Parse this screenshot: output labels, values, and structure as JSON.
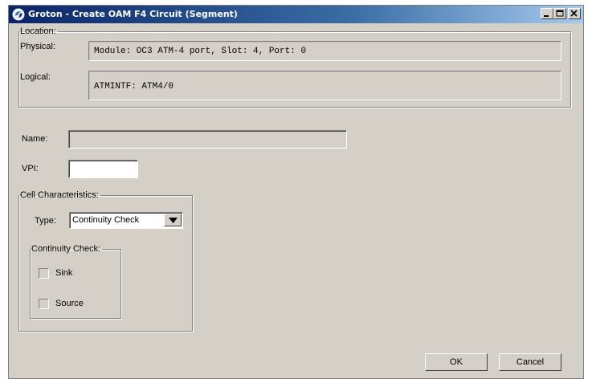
{
  "window": {
    "title": "Groton - Create OAM F4 Circuit (Segment)"
  },
  "location": {
    "legend": "Location:",
    "physical_label": "Physical:",
    "physical_value": "Module: OC3 ATM-4 port, Slot: 4, Port: 0",
    "logical_label": "Logical:",
    "logical_value": "ATMINTF: ATM4/0"
  },
  "form": {
    "name_label": "Name:",
    "name_value": "",
    "vpi_label": "VPI:",
    "vpi_value": ""
  },
  "cell": {
    "legend": "Cell Characteristics:",
    "type_label": "Type:",
    "type_value": "Continuity Check",
    "continuity": {
      "legend": "Continuity Check:",
      "sink_label": "Sink",
      "source_label": "Source",
      "sink_checked": false,
      "source_checked": false
    }
  },
  "buttons": {
    "ok": "OK",
    "cancel": "Cancel"
  },
  "colors": {
    "title_bar": "#0a246a",
    "dialog_bg": "#d4d0c8"
  }
}
